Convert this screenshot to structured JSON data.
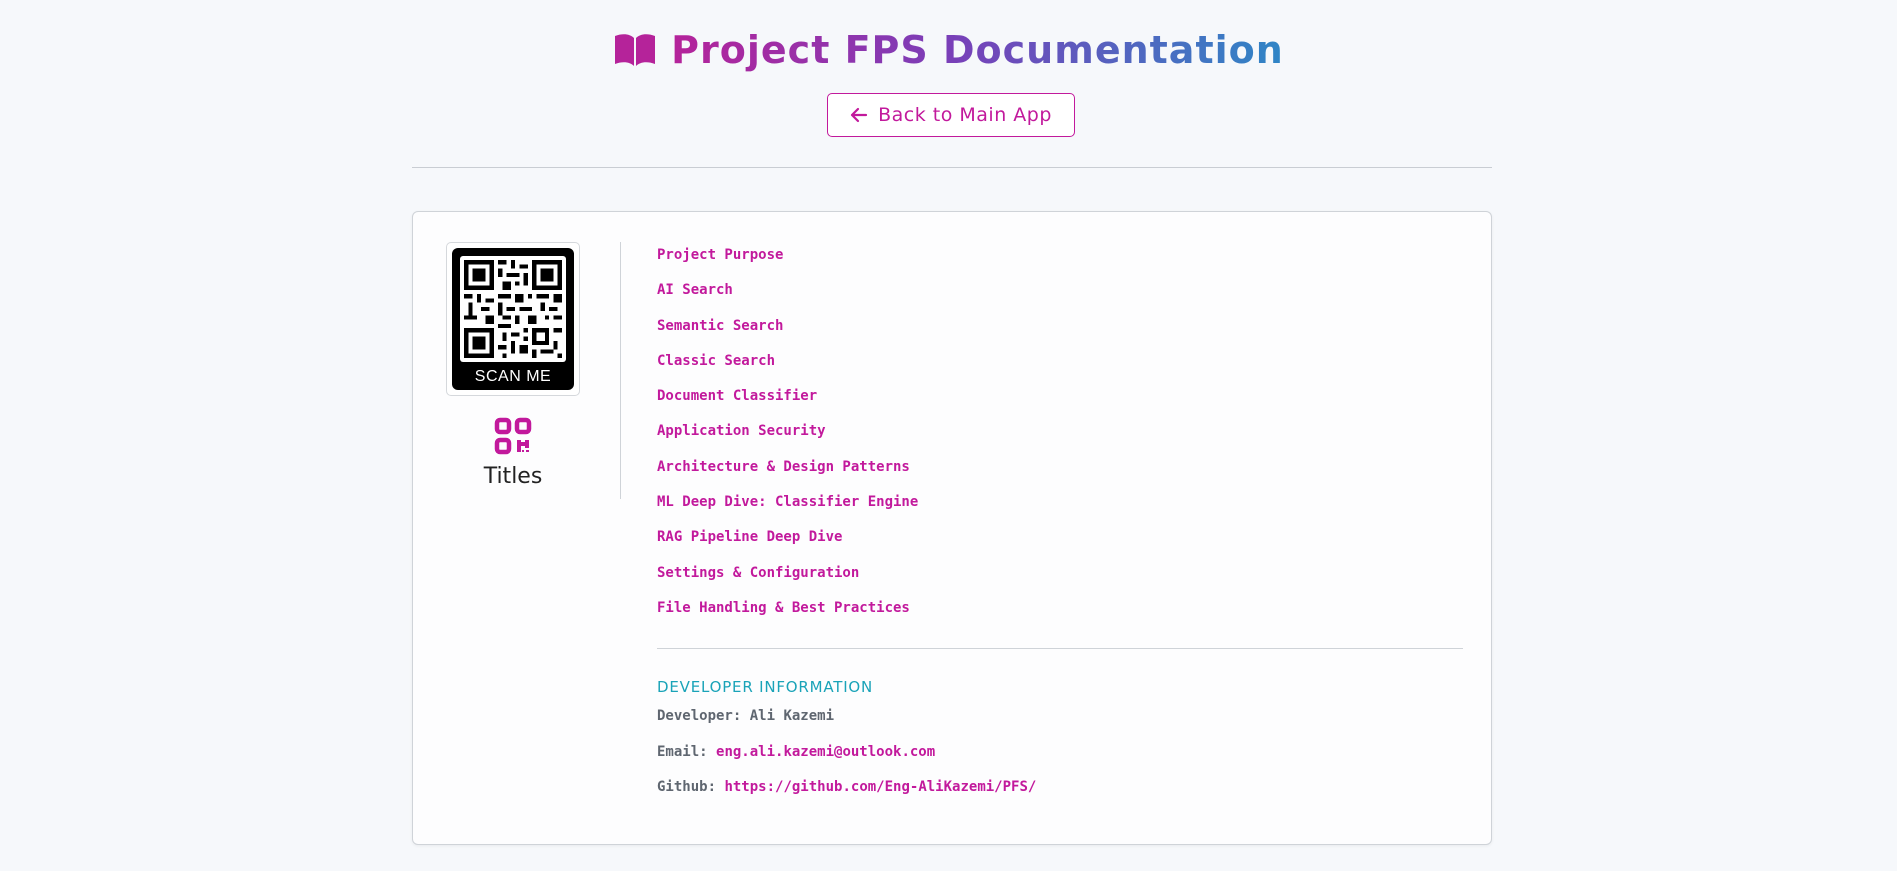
{
  "header": {
    "title": "Project FPS Documentation",
    "title_icon": "book-open-icon",
    "back_button_label": "Back to Main App",
    "back_button_icon": "arrow-left-icon"
  },
  "sidebar": {
    "qr_scan_label": "SCAN ME",
    "qr_icon": "qr-code-icon",
    "titles_label": "Titles"
  },
  "nav": {
    "items": [
      {
        "label": "Project Purpose"
      },
      {
        "label": "AI Search"
      },
      {
        "label": "Semantic Search"
      },
      {
        "label": "Classic Search"
      },
      {
        "label": "Document Classifier"
      },
      {
        "label": "Application Security"
      },
      {
        "label": "Architecture & Design Patterns"
      },
      {
        "label": "ML Deep Dive: Classifier Engine"
      },
      {
        "label": "RAG Pipeline Deep Dive"
      },
      {
        "label": "Settings & Configuration"
      },
      {
        "label": "File Handling & Best Practices"
      }
    ]
  },
  "developer": {
    "heading": "Developer Information",
    "developer_label": "Developer:",
    "developer_name": "Ali Kazemi",
    "email_label": "Email:",
    "email": "eng.ali.kazemi@outlook.com",
    "github_label": "Github:",
    "github_url": "https://github.com/Eng-AliKazemi/PFS/"
  },
  "colors": {
    "accent": "#c2199c",
    "heading_teal": "#1aa3b8",
    "title_gradient_start": "#b5239a",
    "title_gradient_end": "#2f86c6",
    "background": "#f6f8fb"
  }
}
